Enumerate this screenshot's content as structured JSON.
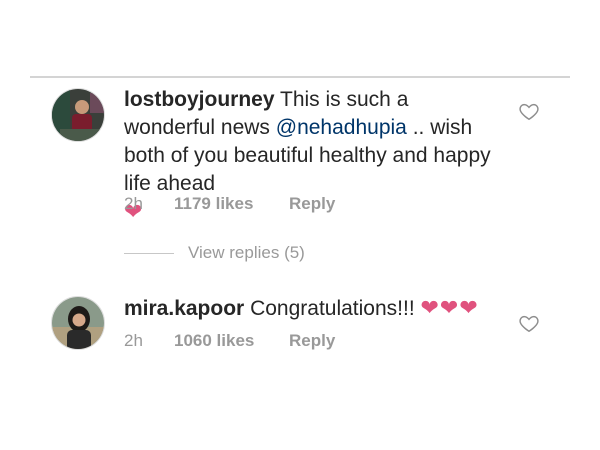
{
  "comments": [
    {
      "username": "lostboyjourney",
      "text_before": "This is such a wonderful news ",
      "mention": "@nehadhupia",
      "text_after": " .. wish both of you beautiful healthy and happy life ahead",
      "emoji": "❤",
      "time": "2h",
      "likes": "1179 likes",
      "reply_label": "Reply",
      "avatar_icon": "user-avatar"
    },
    {
      "username": "mira.kapoor",
      "text_before": "Congratulations!!! ",
      "mention": "",
      "text_after": "",
      "emoji": "❤❤❤",
      "time": "2h",
      "likes": "1060 likes",
      "reply_label": "Reply",
      "avatar_icon": "user-avatar"
    }
  ],
  "view_replies": "View replies (5)",
  "colors": {
    "heart": "#e0527e",
    "mention": "#003569",
    "meta": "#999999",
    "text": "#262626"
  }
}
